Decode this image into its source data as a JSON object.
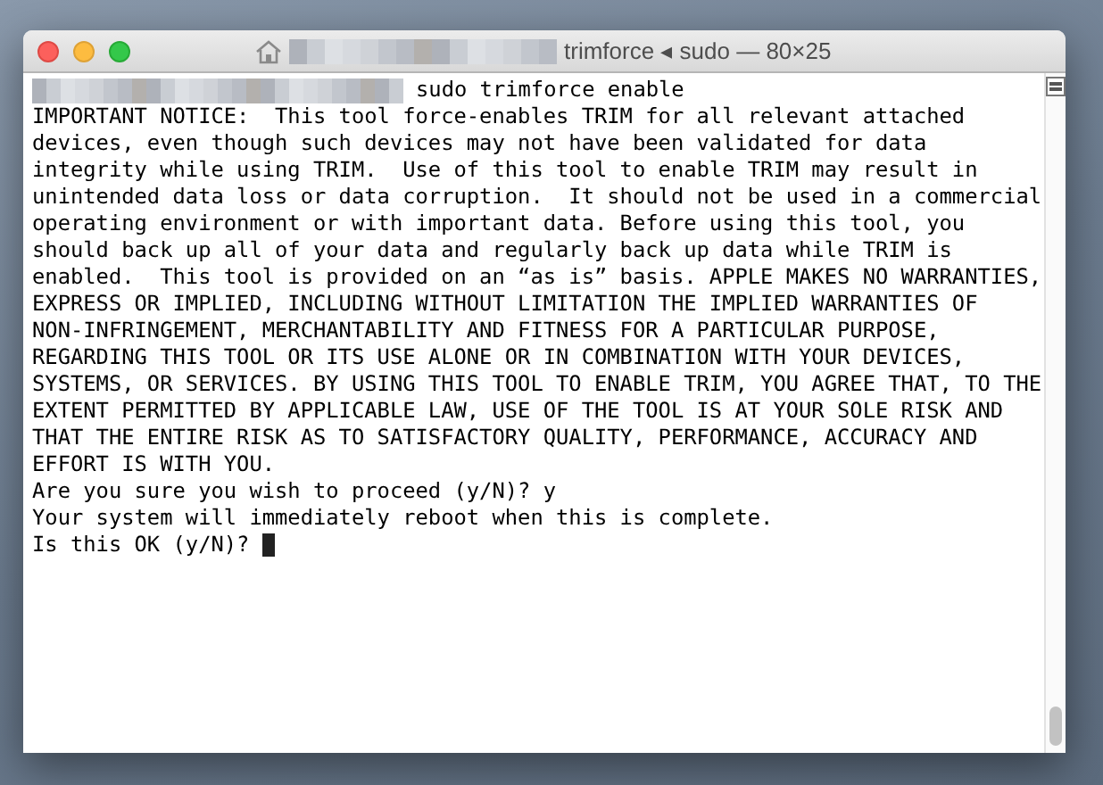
{
  "window": {
    "title": "trimforce ◂ sudo — 80×25"
  },
  "lines": [
    {
      "kind": "command",
      "text": "sudo trimforce enable"
    },
    {
      "kind": "output",
      "text": "IMPORTANT NOTICE:  This tool force-enables TRIM for all relevant attached"
    },
    {
      "kind": "output",
      "text": "devices, even though such devices may not have been validated for data"
    },
    {
      "kind": "output",
      "text": "integrity while using TRIM.  Use of this tool to enable TRIM may result in"
    },
    {
      "kind": "output",
      "text": "unintended data loss or data corruption.  It should not be used in a commercial"
    },
    {
      "kind": "output",
      "text": "operating environment or with important data. Before using this tool, you"
    },
    {
      "kind": "output",
      "text": "should back up all of your data and regularly back up data while TRIM is"
    },
    {
      "kind": "output",
      "text": "enabled.  This tool is provided on an “as is” basis. APPLE MAKES NO WARRANTIES,"
    },
    {
      "kind": "output",
      "text": "EXPRESS OR IMPLIED, INCLUDING WITHOUT LIMITATION THE IMPLIED WARRANTIES OF"
    },
    {
      "kind": "output",
      "text": "NON-INFRINGEMENT, MERCHANTABILITY AND FITNESS FOR A PARTICULAR PURPOSE,"
    },
    {
      "kind": "output",
      "text": "REGARDING THIS TOOL OR ITS USE ALONE OR IN COMBINATION WITH YOUR DEVICES,"
    },
    {
      "kind": "output",
      "text": "SYSTEMS, OR SERVICES. BY USING THIS TOOL TO ENABLE TRIM, YOU AGREE THAT, TO THE"
    },
    {
      "kind": "output",
      "text": "EXTENT PERMITTED BY APPLICABLE LAW, USE OF THE TOOL IS AT YOUR SOLE RISK AND"
    },
    {
      "kind": "output",
      "text": "THAT THE ENTIRE RISK AS TO SATISFACTORY QUALITY, PERFORMANCE, ACCURACY AND"
    },
    {
      "kind": "output",
      "text": "EFFORT IS WITH YOU."
    },
    {
      "kind": "output",
      "text": "Are you sure you wish to proceed (y/N)? y"
    },
    {
      "kind": "output",
      "text": "Your system will immediately reboot when this is complete."
    },
    {
      "kind": "input",
      "text": "Is this OK (y/N)?"
    }
  ]
}
